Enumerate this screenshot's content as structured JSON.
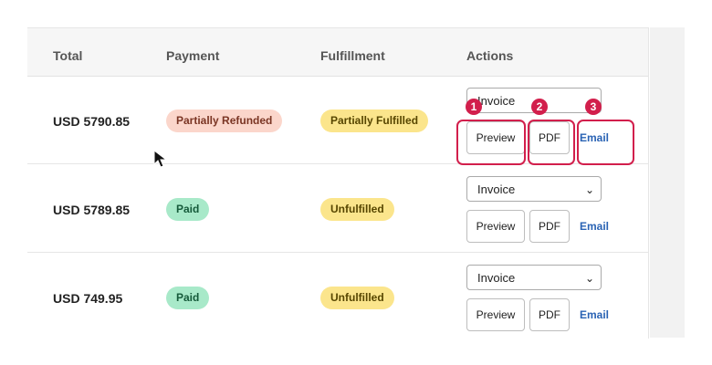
{
  "columns": {
    "total": "Total",
    "payment": "Payment",
    "fulfillment": "Fulfillment",
    "actions": "Actions"
  },
  "rows": [
    {
      "total": "USD 5790.85",
      "payment": {
        "label": "Partially Refunded",
        "color": "#fbd6cb"
      },
      "fulfillment": {
        "label": "Partially Fulfilled",
        "color": "#fbe58c"
      },
      "document_select": "Invoice",
      "preview": "Preview",
      "pdf": "PDF",
      "email": "Email"
    },
    {
      "total": "USD 5789.85",
      "payment": {
        "label": "Paid",
        "color": "#a8e9c9"
      },
      "fulfillment": {
        "label": "Unfulfilled",
        "color": "#fbe58c"
      },
      "document_select": "Invoice",
      "preview": "Preview",
      "pdf": "PDF",
      "email": "Email"
    },
    {
      "total": "USD 749.95",
      "payment": {
        "label": "Paid",
        "color": "#a8e9c9"
      },
      "fulfillment": {
        "label": "Unfulfilled",
        "color": "#fbe58c"
      },
      "document_select": "Invoice",
      "preview": "Preview",
      "pdf": "PDF",
      "email": "Email"
    }
  ],
  "annotations": [
    {
      "number": "1",
      "target": "Preview"
    },
    {
      "number": "2",
      "target": "PDF"
    },
    {
      "number": "3",
      "target": "Email"
    }
  ],
  "accent_color": "#d21f4c",
  "link_color": "#2a63b4",
  "cursor_icon": "arrow-cursor-icon"
}
